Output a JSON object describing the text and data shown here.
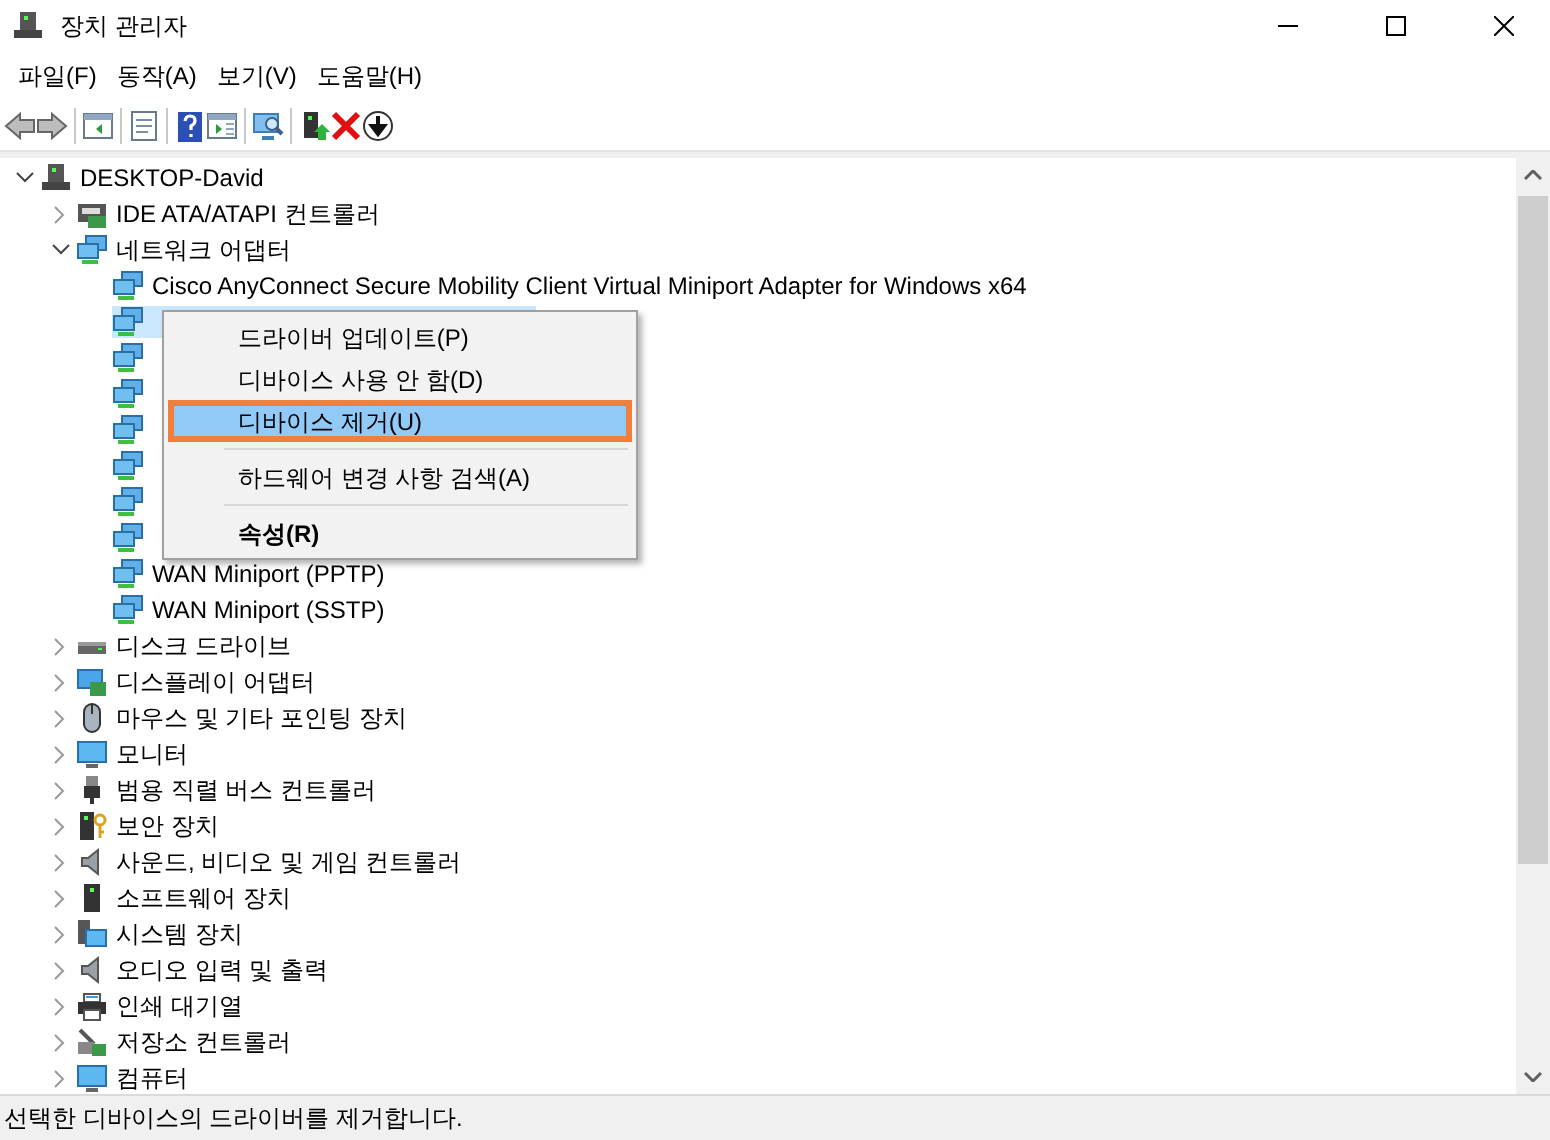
{
  "window": {
    "title": "장치 관리자"
  },
  "menu": [
    "파일(F)",
    "동작(A)",
    "보기(V)",
    "도움말(H)"
  ],
  "toolbar": [
    {
      "kind": "back",
      "disabled": true
    },
    {
      "kind": "forward",
      "disabled": true
    },
    {
      "kind": "sep"
    },
    {
      "kind": "tree-pane"
    },
    {
      "kind": "sep"
    },
    {
      "kind": "properties"
    },
    {
      "kind": "sep"
    },
    {
      "kind": "help"
    },
    {
      "kind": "action-pane"
    },
    {
      "kind": "sep"
    },
    {
      "kind": "scan"
    },
    {
      "kind": "sep"
    },
    {
      "kind": "update"
    },
    {
      "kind": "remove"
    },
    {
      "kind": "disable"
    }
  ],
  "tree": [
    {
      "label": "DESKTOP-David",
      "kind": "computer",
      "expanded": true,
      "children": [
        {
          "label": "IDE ATA/ATAPI 컨트롤러",
          "kind": "ide",
          "expanded": false
        },
        {
          "label": "네트워크 어댑터",
          "kind": "network",
          "expanded": true,
          "children": [
            {
              "label": "Cisco AnyConnect Secure Mobility Client Virtual Miniport Adapter for Windows x64",
              "kind": "network",
              "selected": false
            },
            {
              "kind": "network",
              "selected": true
            },
            {
              "kind": "network",
              "selected": false
            },
            {
              "kind": "network",
              "selected": false
            },
            {
              "kind": "network",
              "selected": false
            },
            {
              "kind": "network",
              "selected": false
            },
            {
              "kind": "network",
              "selected": false
            },
            {
              "kind": "network",
              "selected": false
            },
            {
              "label": "WAN Miniport (PPTP)",
              "kind": "network",
              "selected": false
            },
            {
              "label": "WAN Miniport (SSTP)",
              "kind": "network",
              "selected": false
            }
          ]
        },
        {
          "label": "디스크 드라이브",
          "kind": "disk",
          "expanded": false
        },
        {
          "label": "디스플레이 어댑터",
          "kind": "display",
          "expanded": false
        },
        {
          "label": "마우스 및 기타 포인팅 장치",
          "kind": "mouse",
          "expanded": false
        },
        {
          "label": "모니터",
          "kind": "monitor",
          "expanded": false
        },
        {
          "label": "범용 직렬 버스 컨트롤러",
          "kind": "usb",
          "expanded": false
        },
        {
          "label": "보안 장치",
          "kind": "security",
          "expanded": false
        },
        {
          "label": "사운드, 비디오 및 게임 컨트롤러",
          "kind": "sound",
          "expanded": false
        },
        {
          "label": "소프트웨어 장치",
          "kind": "software",
          "expanded": false
        },
        {
          "label": "시스템 장치",
          "kind": "system",
          "expanded": false
        },
        {
          "label": "오디오 입력 및 출력",
          "kind": "sound",
          "expanded": false
        },
        {
          "label": "인쇄 대기열",
          "kind": "printer",
          "expanded": false
        },
        {
          "label": "저장소 컨트롤러",
          "kind": "storage",
          "expanded": false
        },
        {
          "label": "컴퓨터",
          "kind": "monitor",
          "expanded": false
        }
      ]
    }
  ],
  "context_menu": [
    {
      "kind": "item",
      "label": "드라이버 업데이트(P)",
      "selected": false
    },
    {
      "kind": "item",
      "label": "디바이스 사용 안 함(D)",
      "selected": false
    },
    {
      "kind": "item",
      "label": "디바이스 제거(U)",
      "selected": true,
      "outlined": true
    },
    {
      "kind": "sep"
    },
    {
      "kind": "item",
      "label": "하드웨어 변경 사항 검색(A)",
      "selected": false
    },
    {
      "kind": "sep"
    },
    {
      "kind": "item",
      "label": "속성(R)",
      "selected": false,
      "bold": true
    }
  ],
  "status_bar": "선택한 디바이스의 드라이버를 제거합니다."
}
